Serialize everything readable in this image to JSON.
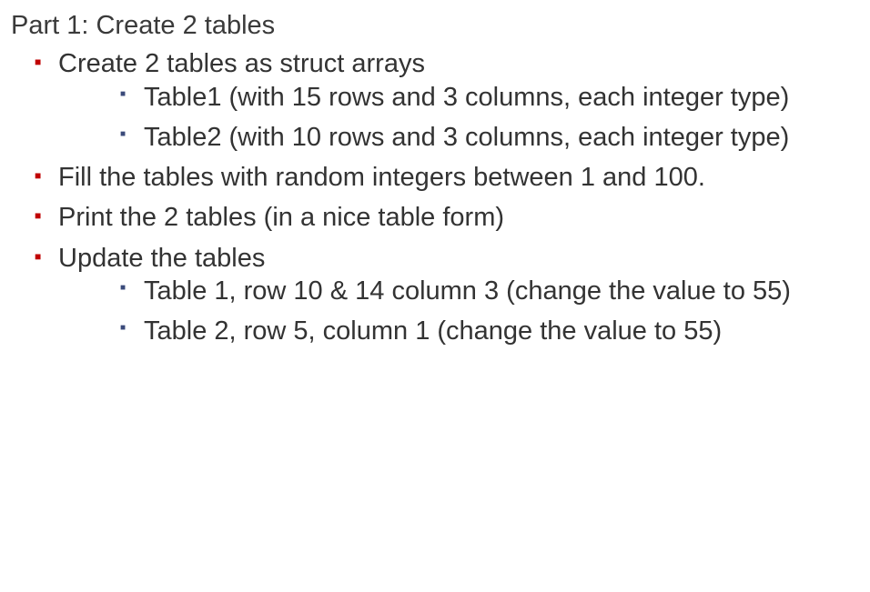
{
  "title": "Part 1: Create 2 tables",
  "items": [
    {
      "text": "Create 2 tables as struct arrays",
      "children": [
        {
          "text": "Table1  (with 15 rows and 3 columns, each integer type)"
        },
        {
          "text": "Table2 (with 10 rows and 3 columns, each integer type)"
        }
      ]
    },
    {
      "text": "Fill the tables with random integers between 1 and 100."
    },
    {
      "text": "Print the 2 tables (in a nice table form)"
    },
    {
      "text": "Update the tables",
      "children": [
        {
          "text": "Table 1, row 10 & 14 column 3  (change the value to 55)"
        },
        {
          "text": "Table 2, row 5, column 1  (change the value to 55)"
        }
      ]
    }
  ]
}
